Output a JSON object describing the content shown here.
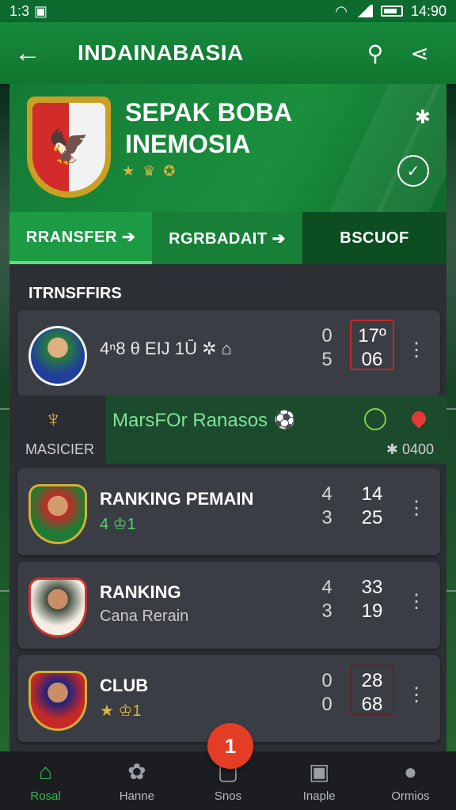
{
  "status_bar": {
    "time_left": "1:3",
    "time_right": "14:90"
  },
  "app_bar": {
    "title": "INDAINABASIA"
  },
  "team": {
    "name_line1": "SEPAK BOBA",
    "name_line2": "INEMOSIA"
  },
  "tabs": [
    {
      "label": "RRANSFER ➔"
    },
    {
      "label": "RGRBADAIT ➔"
    },
    {
      "label": "BSCUOF"
    }
  ],
  "section": {
    "title": "ITRNSFFIRS"
  },
  "cards": [
    {
      "line": "4ⁿ8 θ  EIJ 1Ū ✲ ⌂",
      "score_top": "0",
      "score_bottom": "5",
      "stat_top": "17º",
      "stat_bottom": "06"
    },
    {
      "name": "RANKING PEMAIN",
      "sub": "4 ♔1",
      "score_top": "4",
      "score_bottom": "3",
      "stat_top": "14",
      "stat_bottom": "25"
    },
    {
      "name": "RANKING",
      "sub": "Cana Rerain",
      "score_top": "4",
      "score_bottom": "3",
      "stat_top": "33",
      "stat_bottom": "19"
    },
    {
      "name": "CLUB",
      "sub": "★ ♔1",
      "score_top": "0",
      "score_bottom": "0",
      "stat_top": "28",
      "stat_bottom": "68"
    }
  ],
  "banner": {
    "title": "MarsFOr Ranasos",
    "left_label": "MASICIER",
    "count": "✱ 0400"
  },
  "fab": {
    "label": "1"
  },
  "nav": [
    {
      "label": "Rosal",
      "icon": "home-icon"
    },
    {
      "label": "Hanne",
      "icon": "ball-icon"
    },
    {
      "label": "Snos",
      "icon": "square-icon"
    },
    {
      "label": "Inaple",
      "icon": "badge-icon"
    },
    {
      "label": "Ormios",
      "icon": "person-icon"
    }
  ],
  "colors": {
    "primary_green": "#16893c",
    "accent_red": "#e53d25",
    "active_nav": "#3cb54a"
  }
}
